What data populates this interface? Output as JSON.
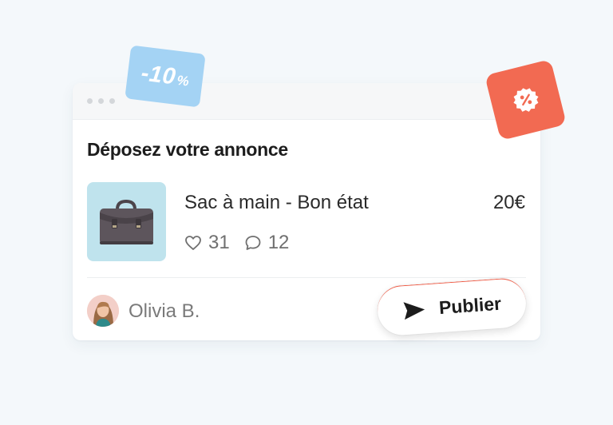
{
  "card": {
    "title": "Déposez votre annonce",
    "item": {
      "name": "Sac à main - Bon état",
      "price": "20€",
      "likes": "31",
      "comments": "12",
      "image": "handbag-image"
    },
    "author": "Olivia B.",
    "publish_label": "Publier"
  },
  "discount_tag": {
    "value": "-10",
    "unit": "%"
  },
  "promo_badge": {
    "icon": "percent-badge-icon"
  },
  "colors": {
    "background": "#f4f8fb",
    "discount_tag": "#a4d3f4",
    "promo_badge": "#f26a52",
    "thumbnail_bg": "#bfe3ed",
    "text_primary": "#1c1c1c",
    "text_muted": "#707070"
  }
}
